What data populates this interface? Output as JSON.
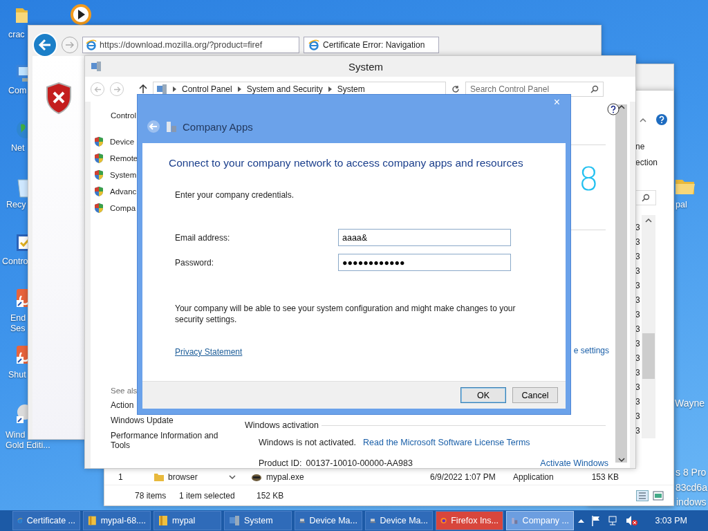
{
  "desktop": {
    "icons": [
      {
        "kind": "folder",
        "lines": [
          "crac"
        ]
      },
      {
        "kind": "computer",
        "lines": [
          "Com"
        ]
      },
      {
        "kind": "globe",
        "lines": [
          "Net"
        ]
      },
      {
        "kind": "bin",
        "lines": [
          "Recy"
        ]
      },
      {
        "kind": "control",
        "lines": [
          "Contro"
        ]
      },
      {
        "kind": "shortcut",
        "lines": [
          "End",
          "Ses"
        ]
      },
      {
        "kind": "shortcut",
        "lines": [
          "Shut"
        ]
      },
      {
        "kind": "disc",
        "lines": [
          "Wind",
          "Gold Editi..."
        ]
      },
      {
        "kind": "media"
      },
      {
        "kind": "folder",
        "lines": [
          "pal"
        ]
      }
    ],
    "edition_lines": [
      "Wayne",
      "s 8 Pro",
      "83cd6a",
      "indows"
    ]
  },
  "browser_window": {
    "address": "https://download.mozilla.org/?product=firef",
    "tab": "Certificate Error: Navigation"
  },
  "explorer_window": {
    "pane_lines": [
      "ne",
      "ection"
    ],
    "size_fragments": [
      "3",
      "3",
      "3",
      "3",
      "3",
      "3",
      "3",
      "3",
      "3",
      "3",
      "3",
      "3",
      "3",
      "3",
      "3"
    ],
    "nav_item": "browser",
    "row_number": "1",
    "file": {
      "name": "mypal.exe",
      "date": "6/9/2022 1:07 PM",
      "type": "Application",
      "size": "153 KB"
    },
    "status": {
      "count": "78 items",
      "selection": "1 item selected",
      "size": "152 KB"
    }
  },
  "system_window": {
    "title": "System",
    "breadcrumb": [
      "Control Panel",
      "System and Security",
      "System"
    ],
    "search_placeholder": "Search Control Panel",
    "home_link": "Control",
    "tasks": [
      "Device",
      "Remote",
      "System",
      "Advanc",
      "Compa"
    ],
    "see_also_title": "See als",
    "see_also": [
      "Action",
      "Windows Update",
      "Performance Information and Tools"
    ],
    "logo_fragment": "8",
    "settings_link": "e settings",
    "activation": {
      "title": "Windows activation",
      "status": "Windows is not activated.",
      "license_link": "Read the Microsoft Software License Terms",
      "product_id_label": "Product ID:",
      "product_id": "00137-10010-00000-AA983",
      "activate_link": "Activate Windows"
    }
  },
  "dialog": {
    "title": "Company Apps",
    "close": "×",
    "heading": "Connect to your company network to access company apps and resources",
    "instruction": "Enter your company credentials.",
    "fields": [
      {
        "label": "Email address:",
        "value": "aaaa&"
      },
      {
        "label": "Password:",
        "value": "●●●●●●●●●●●●"
      }
    ],
    "notice": "Your company will be able to see your system configuration and might make changes to your security settings.",
    "privacy_link": "Privacy Statement",
    "buttons": [
      {
        "label": "OK",
        "default": true
      },
      {
        "label": "Cancel",
        "default": false
      }
    ]
  },
  "taskbar": {
    "items": [
      {
        "kind": "browser",
        "label": "Certificate ...",
        "selected": false,
        "flashing": false
      },
      {
        "kind": "folder",
        "label": "mypal-68....",
        "selected": false,
        "flashing": false
      },
      {
        "kind": "folder",
        "label": "mypal",
        "selected": false,
        "flashing": false
      },
      {
        "kind": "system",
        "label": "System",
        "selected": false,
        "flashing": false
      },
      {
        "kind": "device",
        "label": "Device Ma...",
        "selected": false,
        "flashing": false
      },
      {
        "kind": "device",
        "label": "Device Ma...",
        "selected": false,
        "flashing": false
      },
      {
        "kind": "firefox",
        "label": "Firefox Ins...",
        "selected": false,
        "flashing": true
      },
      {
        "kind": "apps",
        "label": "Company ...",
        "selected": true,
        "flashing": false
      }
    ],
    "clock": "3:03 PM"
  }
}
